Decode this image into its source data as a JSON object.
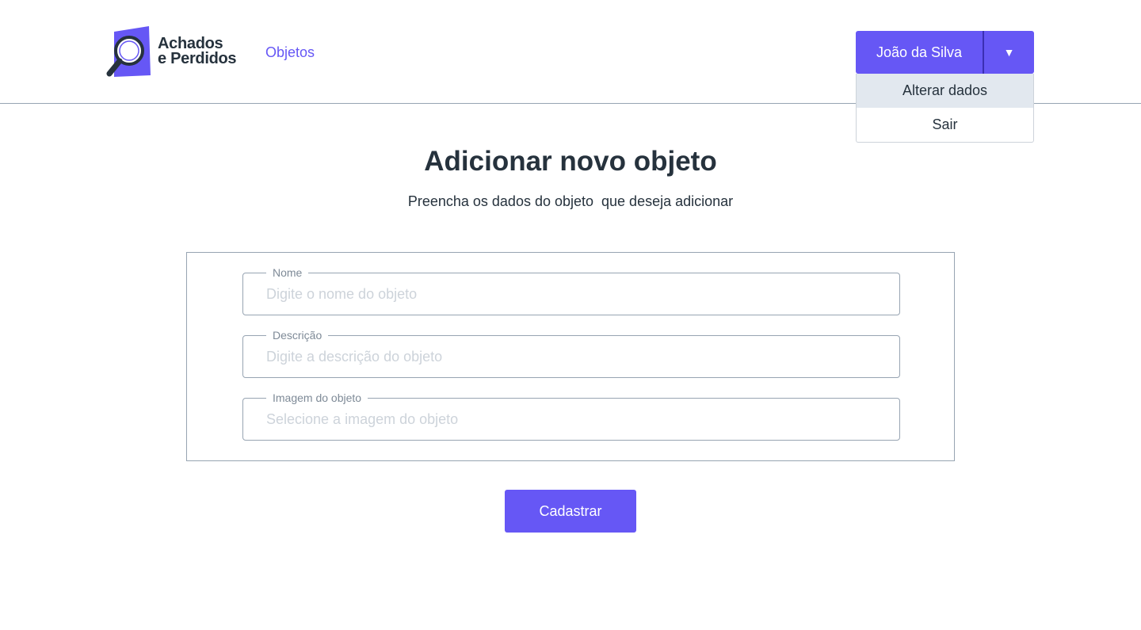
{
  "brand": {
    "line1": "Achados",
    "line2": "e Perdidos",
    "icon": "magnifier-logo-icon",
    "accent_color": "#6657f5"
  },
  "nav": {
    "objetos_label": "Objetos"
  },
  "user_menu": {
    "name": "João da Silva",
    "caret": "▼",
    "items": [
      {
        "label": "Alterar dados"
      },
      {
        "label": "Sair"
      }
    ]
  },
  "main": {
    "title": "Adicionar novo objeto",
    "subtitle": "Preencha os dados do objeto  que deseja adicionar"
  },
  "form": {
    "fields": [
      {
        "label": "Nome",
        "placeholder": "Digite o nome do objeto",
        "value": ""
      },
      {
        "label": "Descrição",
        "placeholder": "Digite a descrição do objeto",
        "value": ""
      },
      {
        "label": "Imagem do objeto",
        "placeholder": "Selecione a imagem do objeto",
        "value": ""
      }
    ],
    "submit_label": "Cadastrar"
  }
}
